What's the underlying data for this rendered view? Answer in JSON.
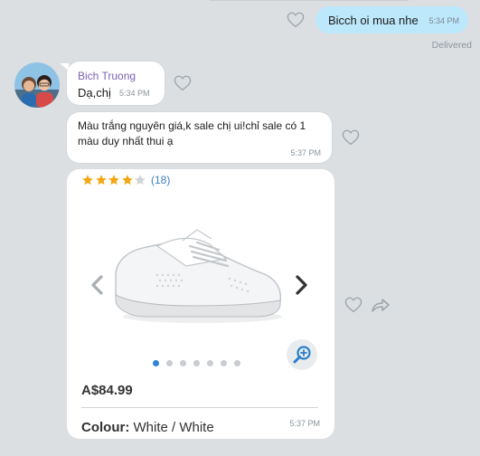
{
  "outgoing": {
    "text": "Bicch oi mua nhe",
    "time": "5:34 PM",
    "status": "Delivered"
  },
  "incoming": [
    {
      "sender": "Bich Truong",
      "text": "Dạ,chị",
      "time": "5:34 PM"
    },
    {
      "text": "Màu trắng nguyên giá,k sale chị ui!chỉ sale có 1 màu duy nhất thui ạ",
      "time": "5:37 PM"
    }
  ],
  "product_card": {
    "rating_stars": 4,
    "rating_max": 5,
    "rating_count": "(18)",
    "price": "A$84.99",
    "colour_label": "Colour:",
    "colour_value": "White / White",
    "time": "5:37 PM",
    "carousel": {
      "total": 7,
      "active": 1
    }
  },
  "colors": {
    "outgoing_bubble": "#bde7fb",
    "sender_name": "#7b63b5",
    "active_dot": "#2f86d8",
    "star": "#f3a712"
  },
  "icons": [
    "heart-icon",
    "share-icon",
    "zoom-in-icon",
    "chevron-left-icon",
    "chevron-right-icon",
    "star-icon"
  ]
}
